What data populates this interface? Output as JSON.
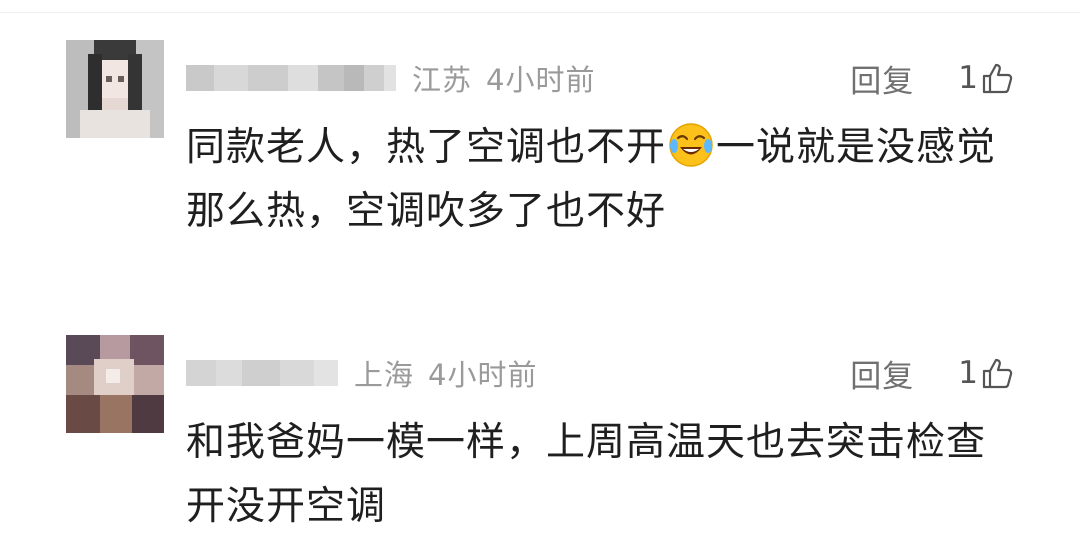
{
  "comments": [
    {
      "avatar": {
        "icon": "avatar-blurred-portrait"
      },
      "location": "江苏",
      "time": "4小时前",
      "reply_label": "回复",
      "like_count": "1",
      "content_part1": "同款老人，热了空调也不开",
      "emoji": "face-with-tears-of-joy-icon",
      "content_part2": "一说就是没感觉那么热，空调吹多了也不好"
    },
    {
      "avatar": {
        "icon": "avatar-blurred-photo"
      },
      "location": "上海",
      "time": "4小时前",
      "reply_label": "回复",
      "like_count": "1",
      "content": "和我爸妈一模一样，上周高温天也去突击检查开没开空调"
    }
  ],
  "colors": {
    "meta_text": "#9a9a9a",
    "reply_text": "#707070",
    "body_text": "#1f1f1f"
  }
}
